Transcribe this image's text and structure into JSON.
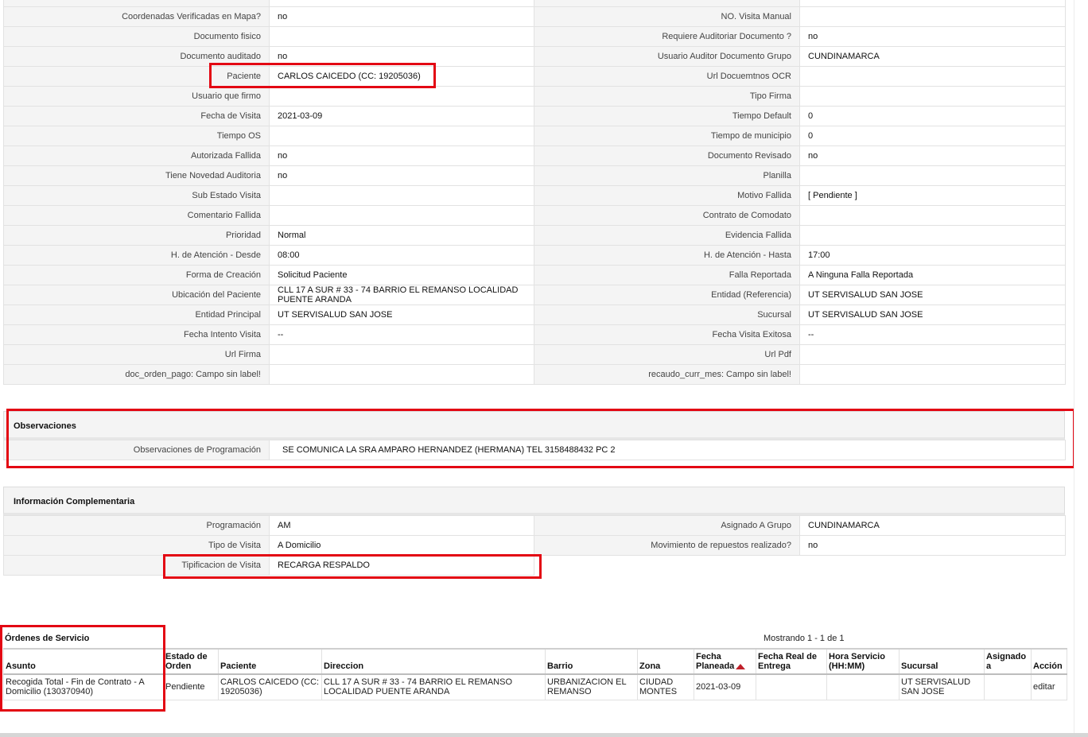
{
  "details": {
    "rows": [
      {
        "l1": "Coordenadas Verificadas en Mapa?",
        "v1": "no",
        "l2": "NO. Visita Manual",
        "v2": ""
      },
      {
        "l1": "Documento fisico",
        "v1": "",
        "l2": "Requiere Auditoriar Documento ?",
        "v2": "no"
      },
      {
        "l1": "Documento auditado",
        "v1": "no",
        "l2": "Usuario Auditor Documento Grupo",
        "v2": "CUNDINAMARCA"
      },
      {
        "l1": "Paciente",
        "v1": "CARLOS CAICEDO (CC: 19205036)",
        "l2": "Url Docuemtnos OCR",
        "v2": ""
      },
      {
        "l1": "Usuario que firmo",
        "v1": "",
        "l2": "Tipo Firma",
        "v2": ""
      },
      {
        "l1": "Fecha de Visita",
        "v1": "2021-03-09",
        "l2": "Tiempo Default",
        "v2": "0"
      },
      {
        "l1": "Tiempo OS",
        "v1": "",
        "l2": "Tiempo de municipio",
        "v2": "0"
      },
      {
        "l1": "Autorizada Fallida",
        "v1": "no",
        "l2": "Documento Revisado",
        "v2": "no"
      },
      {
        "l1": "Tiene Novedad Auditoria",
        "v1": "no",
        "l2": "Planilla",
        "v2": ""
      },
      {
        "l1": "Sub Estado Visita",
        "v1": "",
        "l2": "Motivo Fallida",
        "v2": "[ Pendiente ]"
      },
      {
        "l1": "Comentario Fallida",
        "v1": "",
        "l2": "Contrato de Comodato",
        "v2": ""
      },
      {
        "l1": "Prioridad",
        "v1": "Normal",
        "l2": "Evidencia Fallida",
        "v2": ""
      },
      {
        "l1": "H. de Atención - Desde",
        "v1": "08:00",
        "l2": "H. de Atención - Hasta",
        "v2": "17:00"
      },
      {
        "l1": "Forma de Creación",
        "v1": "Solicitud Paciente",
        "l2": "Falla Reportada",
        "v2": "A Ninguna Falla Reportada"
      },
      {
        "l1": "Ubicación del Paciente",
        "v1": "CLL 17 A SUR # 33 - 74 BARRIO EL REMANSO LOCALIDAD PUENTE ARANDA",
        "l2": "Entidad (Referencia)",
        "v2": "UT SERVISALUD SAN JOSE"
      },
      {
        "l1": "Entidad Principal",
        "v1": "UT SERVISALUD SAN JOSE",
        "l2": "Sucursal",
        "v2": "UT SERVISALUD SAN JOSE"
      },
      {
        "l1": "Fecha Intento Visita",
        "v1": "--",
        "l2": "Fecha Visita Exitosa",
        "v2": "--"
      },
      {
        "l1": "Url Firma",
        "v1": "",
        "l2": "Url Pdf",
        "v2": ""
      },
      {
        "l1": "doc_orden_pago: Campo sin label!",
        "v1": "",
        "l2": "recaudo_curr_mes: Campo sin label!",
        "v2": ""
      }
    ]
  },
  "observaciones": {
    "title": "Observaciones",
    "label": "Observaciones de Programación",
    "value": "SE COMUNICA LA SRA AMPARO HERNANDEZ (HERMANA) TEL 3158488432 PC 2"
  },
  "complementaria": {
    "title": "Información Complementaria",
    "rows": [
      {
        "l1": "Programación",
        "v1": "AM",
        "l2": "Asignado A Grupo",
        "v2": "CUNDINAMARCA"
      },
      {
        "l1": "Tipo de Visita",
        "v1": "A Domicilio",
        "l2": "Movimiento de repuestos realizado?",
        "v2": "no"
      }
    ],
    "tipificacion_label": "Tipificacion de Visita",
    "tipificacion_value": "RECARGA RESPALDO"
  },
  "ordenes": {
    "title": "Órdenes de Servicio",
    "showing": "Mostrando 1 - 1 de 1",
    "columns": [
      "Asunto",
      "Estado de Orden",
      "Paciente",
      "Direccion",
      "Barrio",
      "Zona",
      "Fecha Planeada",
      "Fecha Real de Entrega",
      "Hora Servicio (HH:MM)",
      "Sucursal",
      "Asignado a",
      "Acción"
    ],
    "rows": [
      {
        "asunto": "Recogida Total - Fin de Contrato - A Domicilio (130370940)",
        "estado": "Pendiente",
        "paciente": "CARLOS CAICEDO (CC: 19205036)",
        "direccion": "CLL 17 A SUR # 33 - 74 BARRIO EL REMANSO LOCALIDAD PUENTE ARANDA",
        "barrio": "URBANIZACION EL REMANSO",
        "zona": "CIUDAD MONTES",
        "fecha_planeada": "2021-03-09",
        "fecha_real": "",
        "hora": "",
        "sucursal": "UT SERVISALUD SAN JOSE",
        "asignado": "",
        "accion": "editar"
      }
    ]
  },
  "colors": {
    "highlight": "#e30613",
    "label_bg": "#f4f4f4",
    "sort_arrow": "#c0202a"
  }
}
